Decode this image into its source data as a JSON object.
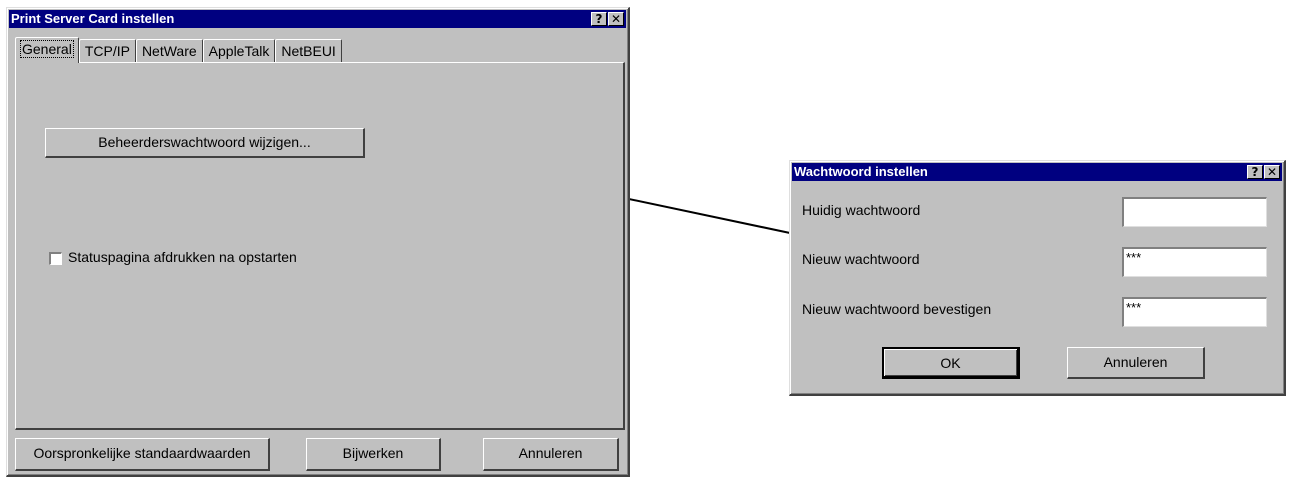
{
  "main_dialog": {
    "title": "Print Server Card instellen",
    "help_button": "?",
    "close_button": "✕",
    "tabs": [
      {
        "label": "General"
      },
      {
        "label": "TCP/IP"
      },
      {
        "label": "NetWare"
      },
      {
        "label": "AppleTalk"
      },
      {
        "label": "NetBEUI"
      }
    ],
    "change_password_button": "Beheerderswachtwoord wijzigen...",
    "status_checkbox_label": "Statuspagina afdrukken na opstarten",
    "status_checkbox_checked": false,
    "defaults_button": "Oorspronkelijke standaardwaarden",
    "update_button": "Bijwerken",
    "cancel_button": "Annuleren"
  },
  "password_dialog": {
    "title": "Wachtwoord instellen",
    "help_button": "?",
    "close_button": "✕",
    "current_label": "Huidig wachtwoord",
    "current_value": "",
    "new_label": "Nieuw wachtwoord",
    "new_value": "***",
    "confirm_label": "Nieuw wachtwoord bevestigen",
    "confirm_value": "***",
    "ok_button": "OK",
    "cancel_button": "Annuleren"
  },
  "colors": {
    "titlebar": "#000080",
    "face": "#c0c0c0"
  }
}
